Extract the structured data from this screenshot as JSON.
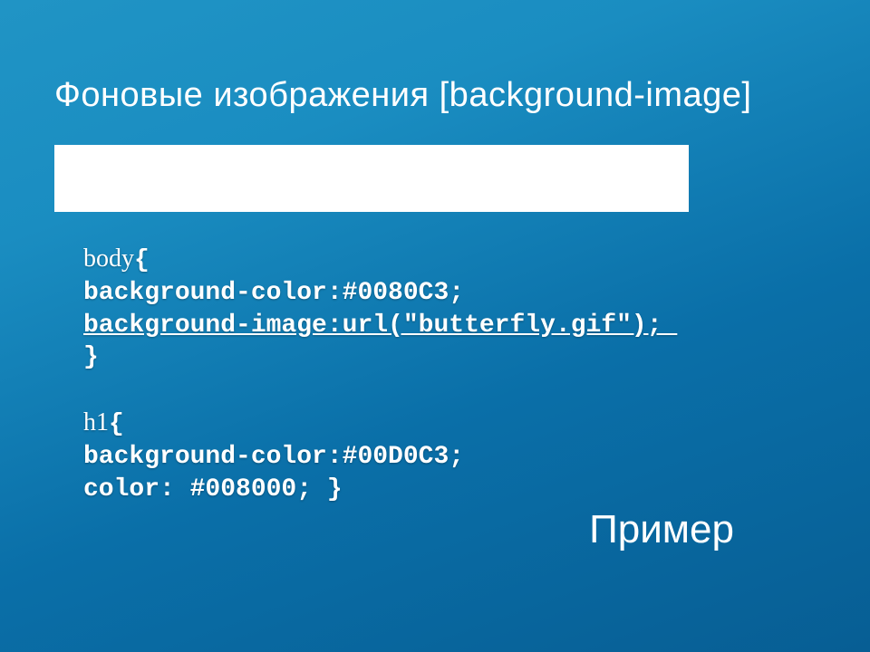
{
  "title": "Фоновые изображения [background-image]",
  "code": {
    "l1a": "body",
    "l1b": "{",
    "l2": "background-color:#0080C3;",
    "l3": "background-image:url(\"butterfly.gif\"); ",
    "l4": "}",
    "blank": " ",
    "l5a": "h1",
    "l5b": "{",
    "l6": "background-color:#00D0C3;",
    "l7": "color: #008000; }"
  },
  "example": "Пример"
}
